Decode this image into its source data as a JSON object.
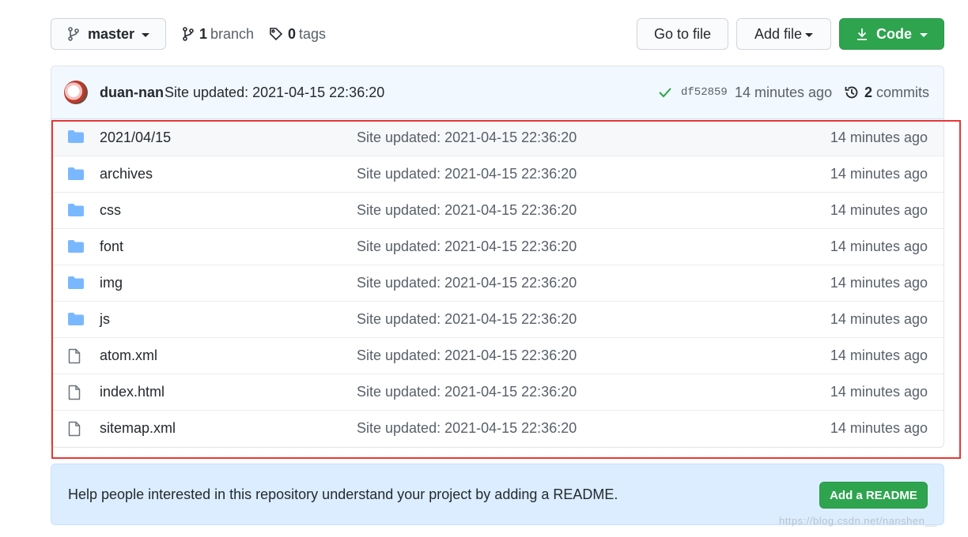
{
  "toolbar": {
    "branch_name": "master",
    "branch_count": "1",
    "branch_label": "branch",
    "tag_count": "0",
    "tag_label": "tags",
    "go_to_file": "Go to file",
    "add_file": "Add file",
    "code": "Code"
  },
  "commit": {
    "author": "duan-nan",
    "message": "Site updated: 2021-04-15 22:36:20",
    "sha": "df52859",
    "time": "14 minutes ago",
    "commit_count": "2",
    "commit_label": "commits"
  },
  "files": [
    {
      "type": "folder",
      "name": "2021/04/15",
      "message": "Site updated: 2021-04-15 22:36:20",
      "time": "14 minutes ago"
    },
    {
      "type": "folder",
      "name": "archives",
      "message": "Site updated: 2021-04-15 22:36:20",
      "time": "14 minutes ago"
    },
    {
      "type": "folder",
      "name": "css",
      "message": "Site updated: 2021-04-15 22:36:20",
      "time": "14 minutes ago"
    },
    {
      "type": "folder",
      "name": "font",
      "message": "Site updated: 2021-04-15 22:36:20",
      "time": "14 minutes ago"
    },
    {
      "type": "folder",
      "name": "img",
      "message": "Site updated: 2021-04-15 22:36:20",
      "time": "14 minutes ago"
    },
    {
      "type": "folder",
      "name": "js",
      "message": "Site updated: 2021-04-15 22:36:20",
      "time": "14 minutes ago"
    },
    {
      "type": "file",
      "name": "atom.xml",
      "message": "Site updated: 2021-04-15 22:36:20",
      "time": "14 minutes ago"
    },
    {
      "type": "file",
      "name": "index.html",
      "message": "Site updated: 2021-04-15 22:36:20",
      "time": "14 minutes ago"
    },
    {
      "type": "file",
      "name": "sitemap.xml",
      "message": "Site updated: 2021-04-15 22:36:20",
      "time": "14 minutes ago"
    }
  ],
  "readme": {
    "text": "Help people interested in this repository understand your project by adding a README.",
    "button": "Add a README"
  },
  "watermark": "https://blog.csdn.net/nanshen__",
  "colors": {
    "green": "#2ea44f",
    "folder_blue": "#79b8ff",
    "highlight_red": "#e53935"
  }
}
